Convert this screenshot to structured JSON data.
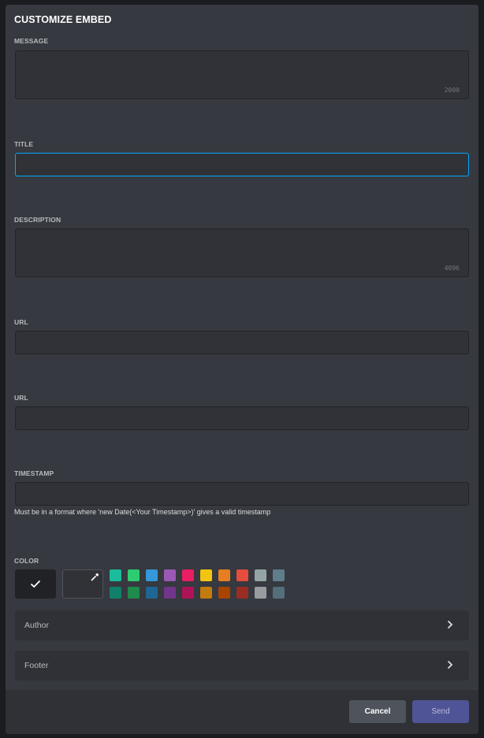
{
  "modal": {
    "title": "CUSTOMIZE EMBED"
  },
  "fields": {
    "message": {
      "label": "MESSAGE",
      "value": "",
      "counter": "2000"
    },
    "title": {
      "label": "TITLE",
      "value": ""
    },
    "description": {
      "label": "DESCRIPTION",
      "value": "",
      "counter": "4096"
    },
    "url1": {
      "label": "URL",
      "value": ""
    },
    "url2": {
      "label": "URL",
      "value": ""
    },
    "timestamp": {
      "label": "TIMESTAMP",
      "value": "",
      "hint": "Must be in a format where 'new Date(<Your Timestamp>)' gives a valid timestamp"
    }
  },
  "color": {
    "label": "COLOR",
    "selected_icon": "checkmark-icon",
    "custom_icon": "eyedropper-icon",
    "swatches_top": [
      "#1abc9c",
      "#2ecc71",
      "#3498db",
      "#9b59b6",
      "#e91e63",
      "#f1c40f",
      "#e67e22",
      "#e74c3c",
      "#95a5a6",
      "#607d8b"
    ],
    "swatches_bottom": [
      "#11806a",
      "#1f8b4c",
      "#206694",
      "#71368a",
      "#ad1457",
      "#c27c0e",
      "#a84300",
      "#992d22",
      "#979c9f",
      "#546e7a"
    ]
  },
  "sections": {
    "author": {
      "label": "Author",
      "icon": "chevron-right-icon"
    },
    "footer": {
      "label": "Footer",
      "icon": "chevron-right-icon"
    }
  },
  "buttons": {
    "cancel": "Cancel",
    "send": "Send"
  }
}
